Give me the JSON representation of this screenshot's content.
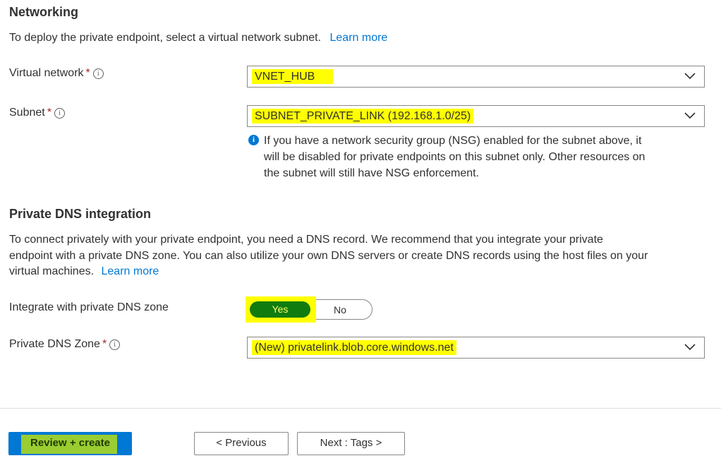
{
  "networking": {
    "title": "Networking",
    "description": "To deploy the private endpoint, select a virtual network subnet.",
    "learn_more": "Learn more"
  },
  "fields": {
    "vnet": {
      "label": "Virtual network",
      "required": "*",
      "value": "VNET_HUB"
    },
    "subnet": {
      "label": "Subnet",
      "required": "*",
      "value": "SUBNET_PRIVATE_LINK (192.168.1.0/25)"
    },
    "nsg_note": {
      "line1": "If you have a network security group (NSG) enabled for the subnet above, it",
      "line2": "will be disabled for private endpoints on this subnet only. Other resources on",
      "line3": "the subnet will still have NSG enforcement."
    }
  },
  "dns": {
    "title": "Private DNS integration",
    "description_line1": "To connect privately with your private endpoint, you need a DNS record. We recommend that you integrate your private",
    "description_line2": "endpoint with a private DNS zone. You can also utilize your own DNS servers or create DNS records using the host files on your",
    "description_line3": "virtual machines.",
    "learn_more": "Learn more",
    "integrate": {
      "label": "Integrate with private DNS zone",
      "yes": "Yes",
      "no": "No",
      "selected": "Yes"
    },
    "zone": {
      "label": "Private DNS Zone",
      "required": "*",
      "value": "(New) privatelink.blob.core.windows.net"
    }
  },
  "footer": {
    "review_create": "Review + create",
    "previous": "< Previous",
    "next": "Next : Tags >"
  },
  "colors": {
    "accent": "#0078d4",
    "highlight": "#ffff00",
    "toggle_on": "#107c10",
    "required": "#a4262c"
  }
}
